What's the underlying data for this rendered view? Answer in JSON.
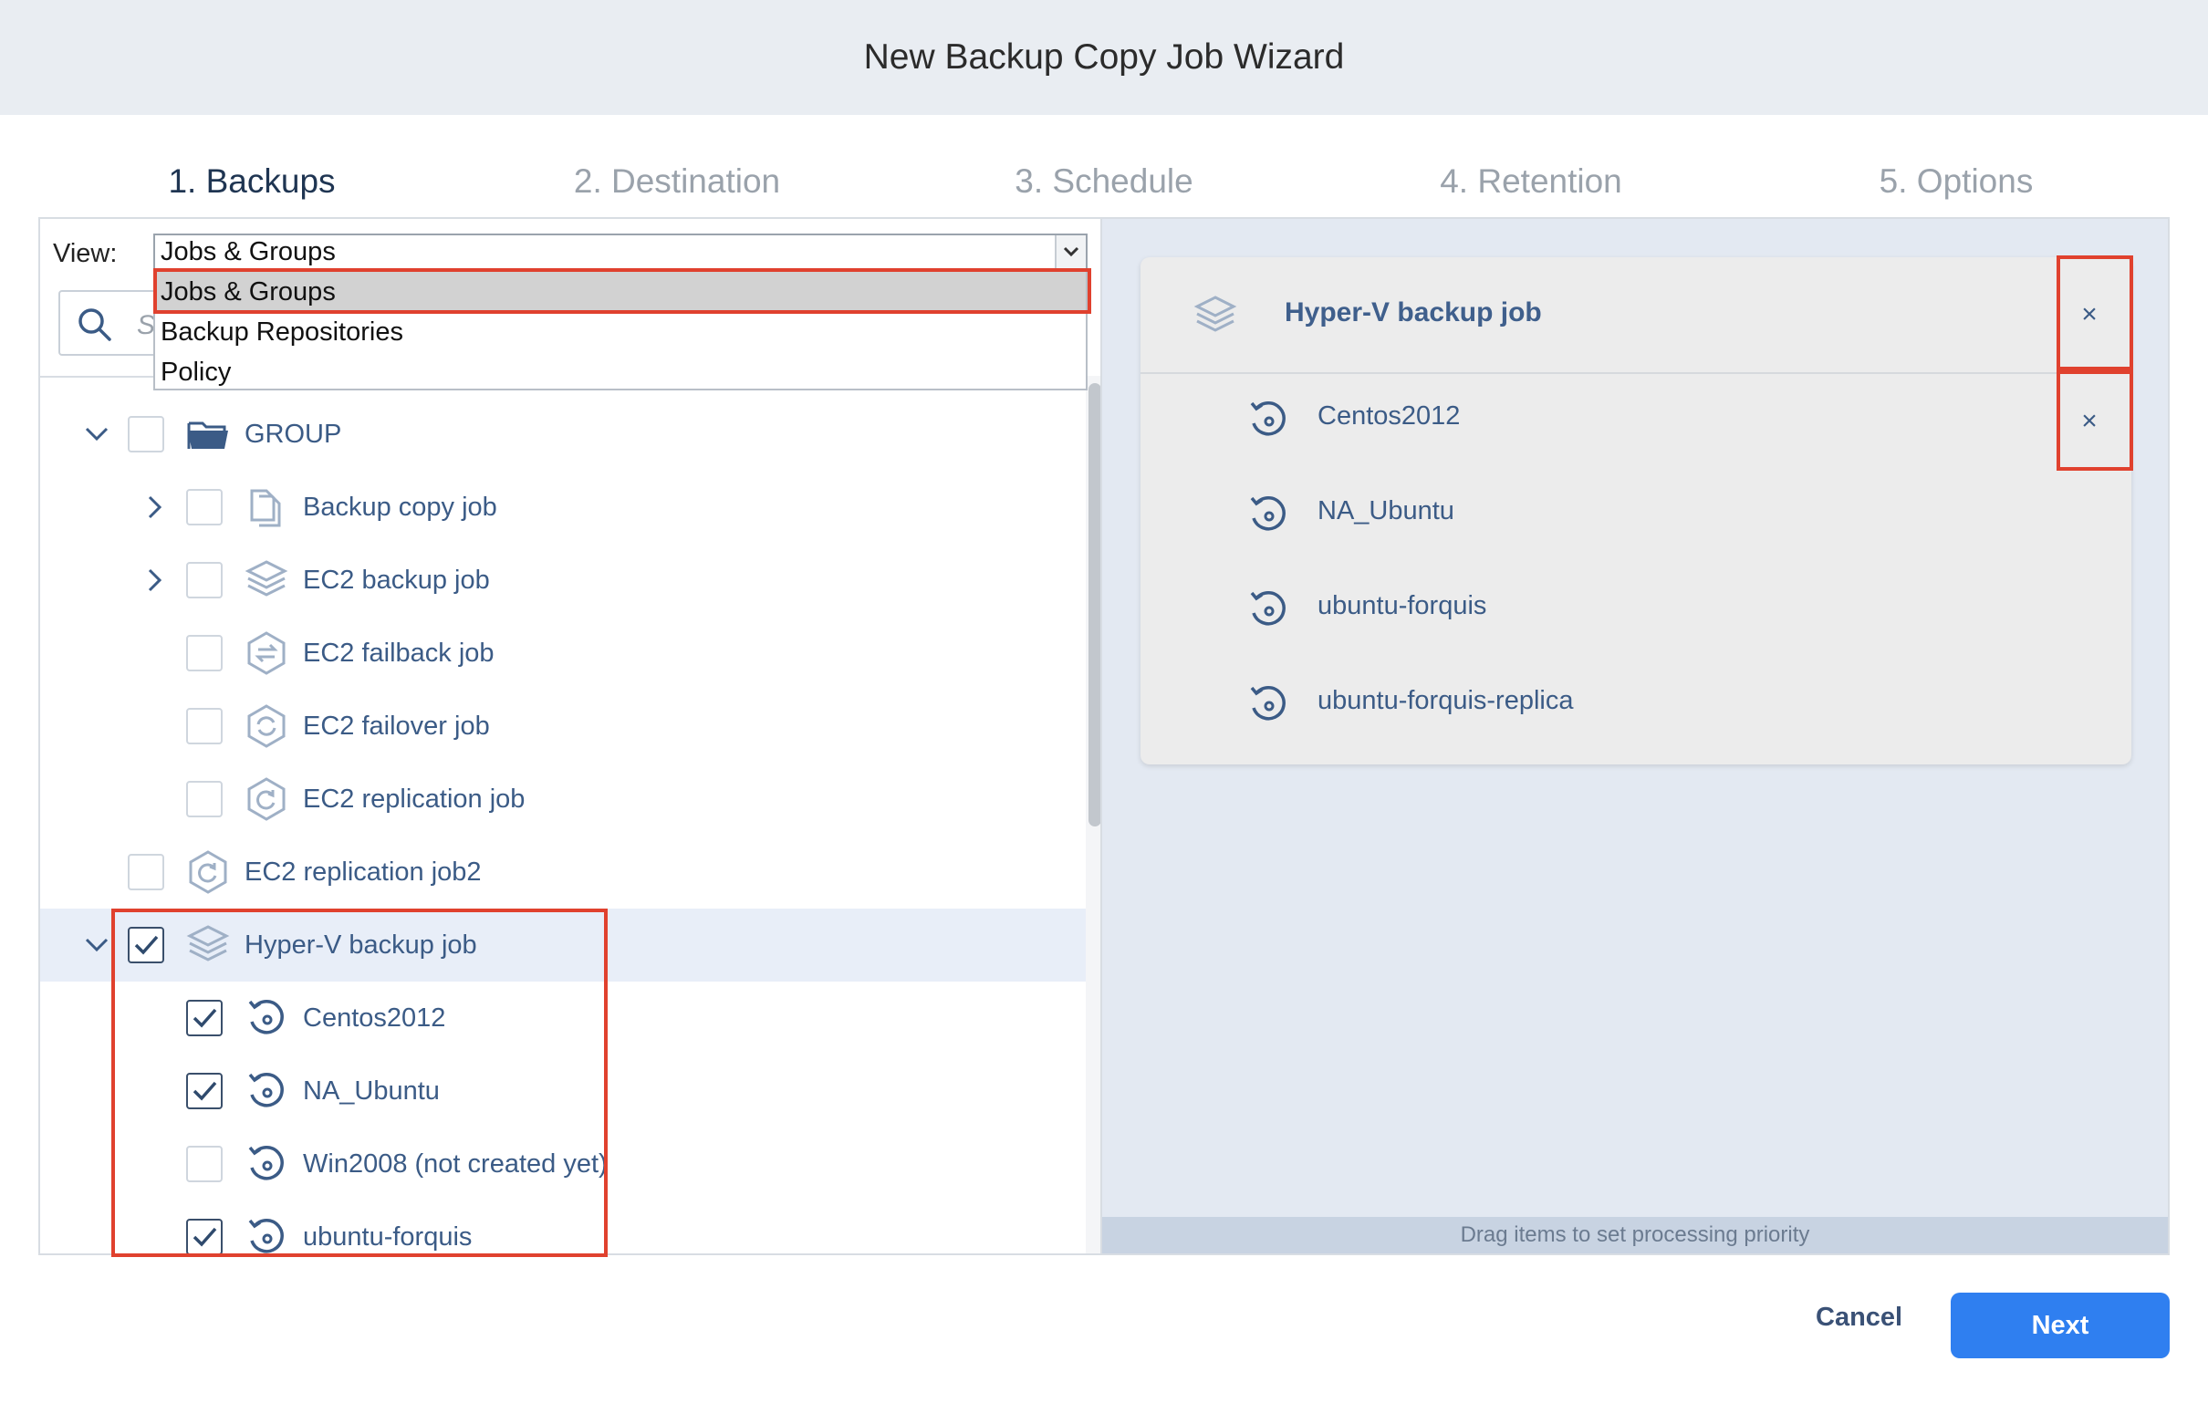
{
  "window": {
    "title": "New Backup Copy Job Wizard"
  },
  "steps": [
    {
      "label": "1. Backups",
      "active": true
    },
    {
      "label": "2. Destination",
      "active": false
    },
    {
      "label": "3. Schedule",
      "active": false
    },
    {
      "label": "4. Retention",
      "active": false
    },
    {
      "label": "5. Options",
      "active": false
    }
  ],
  "view": {
    "label": "View:",
    "selected": "Jobs & Groups",
    "options": [
      "Jobs & Groups",
      "Backup Repositories",
      "Policy"
    ]
  },
  "search": {
    "placeholder": "S"
  },
  "tree": [
    {
      "label": "GROUP",
      "icon": "folder-icon",
      "level": 0,
      "expanded": true,
      "checked": false
    },
    {
      "label": "Backup copy job",
      "icon": "backup-copy-icon",
      "level": 1,
      "expandable": true,
      "checked": false
    },
    {
      "label": "EC2 backup job",
      "icon": "layers-icon",
      "level": 1,
      "expandable": true,
      "checked": false
    },
    {
      "label": "EC2 failback job",
      "icon": "failback-icon",
      "level": 1,
      "checked": false
    },
    {
      "label": "EC2 failover job",
      "icon": "failover-icon",
      "level": 1,
      "checked": false
    },
    {
      "label": "EC2 replication job",
      "icon": "replication-icon",
      "level": 1,
      "checked": false
    },
    {
      "label": "EC2 replication job2",
      "icon": "replication-icon",
      "level": 0,
      "checked": false
    },
    {
      "label": "Hyper-V backup job",
      "icon": "layers-icon",
      "level": 0,
      "expanded": true,
      "checked": true
    },
    {
      "label": "Centos2012",
      "icon": "vm-restore-icon",
      "level": 1,
      "checked": true
    },
    {
      "label": "NA_Ubuntu",
      "icon": "vm-restore-icon",
      "level": 1,
      "checked": true
    },
    {
      "label": "Win2008 (not created yet)",
      "icon": "vm-restore-icon",
      "level": 1,
      "checked": false
    },
    {
      "label": "ubuntu-forquis",
      "icon": "vm-restore-icon",
      "level": 1,
      "checked": true
    }
  ],
  "selection": {
    "job": "Hyper-V backup job",
    "items": [
      "Centos2012",
      "NA_Ubuntu",
      "ubuntu-forquis",
      "ubuntu-forquis-replica"
    ],
    "remove_glyph": "×",
    "drag_hint": "Drag items to set processing priority"
  },
  "footer": {
    "cancel": "Cancel",
    "next": "Next"
  },
  "colors": {
    "accent": "#2f7ff0",
    "highlight_box": "#e0412e",
    "text": "#3b5b86"
  }
}
